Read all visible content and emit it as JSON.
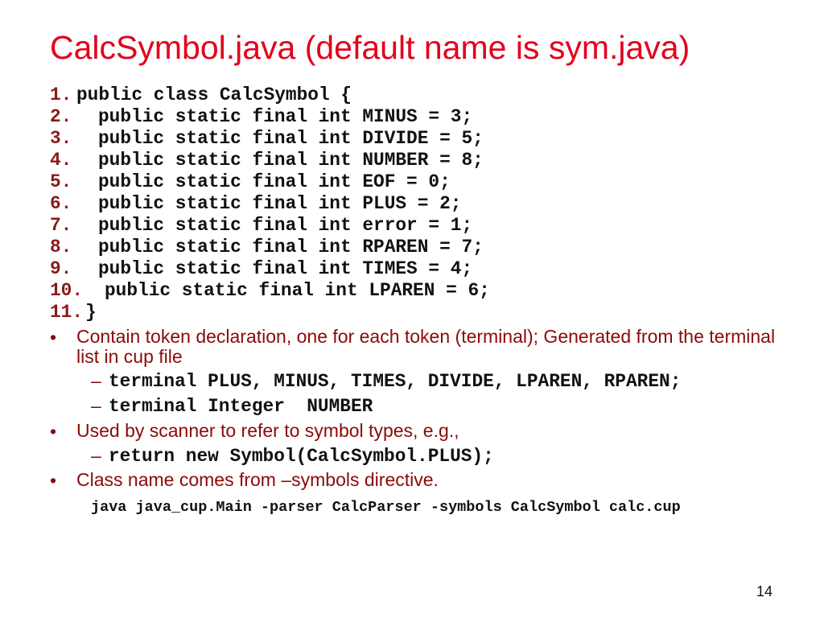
{
  "title": "CalcSymbol.java (default name is sym.java)",
  "code": [
    {
      "n": "1.",
      "t": "public class CalcSymbol {"
    },
    {
      "n": "2.",
      "t": "public static final int MINUS = 3;"
    },
    {
      "n": "3.",
      "t": "public static final int DIVIDE = 5;"
    },
    {
      "n": "4.",
      "t": "public static final int NUMBER = 8;"
    },
    {
      "n": "5.",
      "t": "public static final int EOF = 0;"
    },
    {
      "n": "6.",
      "t": "public static final int PLUS = 2;"
    },
    {
      "n": "7.",
      "t": "public static final int error = 1;"
    },
    {
      "n": "8.",
      "t": "public static final int RPAREN = 7;"
    },
    {
      "n": "9.",
      "t": "public static final int TIMES = 4;"
    },
    {
      "n": "10.",
      "t": "public static final int LPAREN = 6;"
    },
    {
      "n": "11.",
      "t": "}"
    }
  ],
  "bullets": [
    {
      "mark": "•",
      "text": "Contain token declaration, one for each token (terminal); Generated from the terminal list in cup file",
      "subs": [
        {
          "dash": "–",
          "text": "terminal PLUS, MINUS, TIMES, DIVIDE, LPAREN, RPAREN;"
        },
        {
          "dash": "–",
          "text": "terminal Integer  NUMBER"
        }
      ]
    },
    {
      "mark": "•",
      "text": "Used by scanner to refer to symbol types, e.g.,",
      "subs": [
        {
          "dash": "–",
          "text": "return new Symbol(CalcSymbol.PLUS);"
        }
      ]
    },
    {
      "mark": "•",
      "text": "Class name comes from –symbols directive."
    }
  ],
  "command": "java java_cup.Main -parser CalcParser -symbols CalcSymbol calc.cup",
  "page_number": "14"
}
